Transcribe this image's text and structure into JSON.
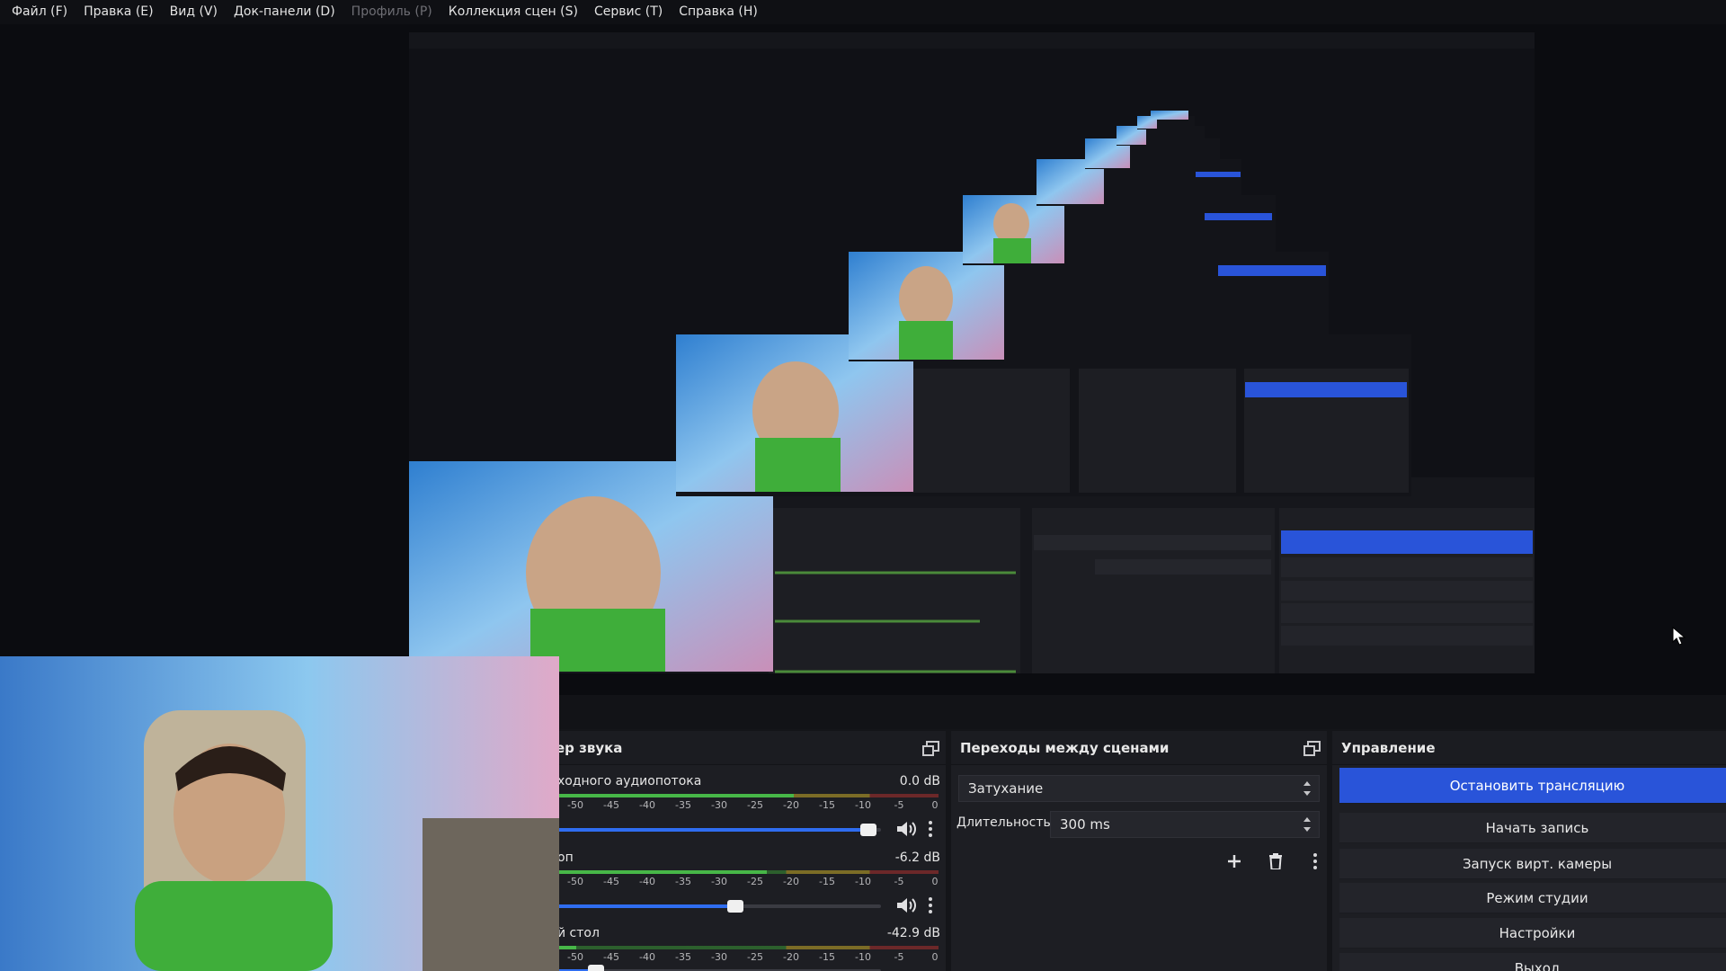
{
  "menu": {
    "items": [
      {
        "label": "Файл (F)",
        "enabled": true
      },
      {
        "label": "Правка (E)",
        "enabled": true
      },
      {
        "label": "Вид (V)",
        "enabled": true
      },
      {
        "label": "Док-панели (D)",
        "enabled": true
      },
      {
        "label": "Профиль (P)",
        "enabled": false
      },
      {
        "label": "Коллекция сцен (S)",
        "enabled": true
      },
      {
        "label": "Сервис (T)",
        "enabled": true
      },
      {
        "label": "Справка (H)",
        "enabled": true
      }
    ]
  },
  "mixer": {
    "title": "ер звука",
    "tick_labels": [
      "-50",
      "-45",
      "-40",
      "-35",
      "-30",
      "-25",
      "-20",
      "-15",
      "-10",
      "-5",
      "0"
    ],
    "channels": [
      {
        "name": "ходного аудиопотока",
        "db": "0.0 dB",
        "volume": 0.96,
        "level": 0.62
      },
      {
        "name": "оп",
        "db": "-6.2 dB",
        "volume": 0.55,
        "level": 0.55
      },
      {
        "name": "й стол",
        "db": "-42.9 dB",
        "volume": 0.12,
        "level": 0.05
      }
    ]
  },
  "transitions": {
    "title": "Переходы между сценами",
    "selected": "Затухание",
    "duration_label": "Длительность",
    "duration_value": "300 ms"
  },
  "controls": {
    "title": "Управление",
    "buttons": [
      "Остановить трансляцию",
      "Начать запись",
      "Запуск вирт. камеры",
      "Режим студии",
      "Настройки",
      "Выход"
    ]
  },
  "colors": {
    "accent": "#2954d9",
    "panel": "#1d1e23",
    "background": "#0b0c10"
  }
}
